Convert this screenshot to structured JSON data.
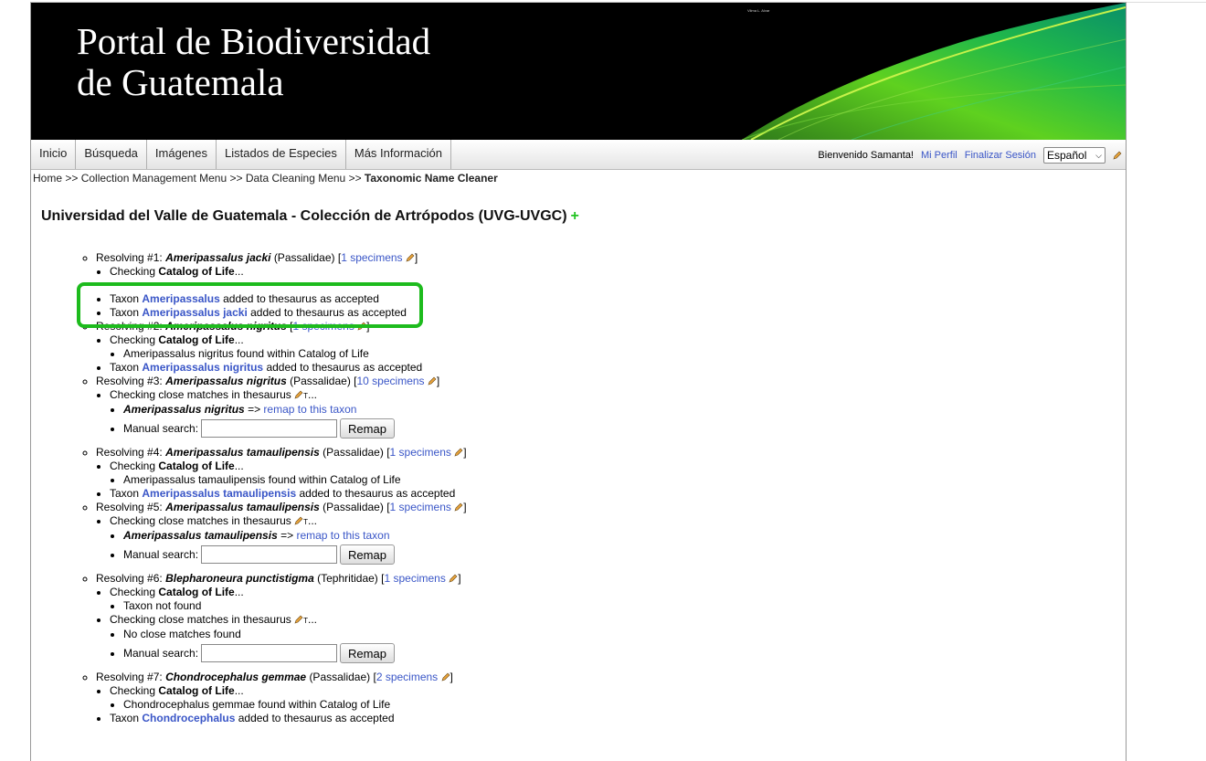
{
  "banner": {
    "title_line1": "Portal de Biodiversidad",
    "title_line2": "de Guatemala",
    "tiny_text": "Vilma L. Alvar"
  },
  "nav": {
    "items": [
      "Inicio",
      "Búsqueda",
      "Imágenes",
      "Listados de Especies",
      "Más Información"
    ]
  },
  "user": {
    "welcome": "Bienvenido Samanta!",
    "profile": "Mi Perfil",
    "logout": "Finalizar Sesión",
    "language": "Español"
  },
  "breadcrumb": {
    "home": "Home >>",
    "cm": "Collection Management Menu >>",
    "dc": "Data Cleaning Menu >>",
    "current": "Taxonomic Name Cleaner"
  },
  "collection_title": "Universidad del Valle de Guatemala - Colección de Artrópodos (UVG-UVGC)",
  "remap_label": "Remap",
  "manual_label": "Manual search:",
  "results": {
    "r1": {
      "head": "Resolving #1:",
      "taxon": "Ameripassalus jacki",
      "family": "(Passalidae)",
      "spec": "1 specimens",
      "check": "Checking",
      "source": "Catalog of Life",
      "t1name": "Ameripassalus",
      "t2name": "Ameripassalus jacki",
      "accepted": "added to thesaurus as accepted"
    },
    "r2": {
      "head": "Resolving #2:",
      "taxon": "Ameripassalus nigritus",
      "spec": "1 specimens",
      "found": "Ameripassalus nigritus found within Catalog of Life",
      "tname": "Ameripassalus nigritus"
    },
    "r3": {
      "head": "Resolving #3:",
      "taxon": "Ameripassalus nigritus",
      "family": "(Passalidae)",
      "spec": "10 specimens",
      "close": "Checking close matches in thesaurus",
      "match": "Ameripassalus nigritus",
      "remap": "remap to this taxon"
    },
    "r4": {
      "head": "Resolving #4:",
      "taxon": "Ameripassalus tamaulipensis",
      "family": "(Passalidae)",
      "spec": "1 specimens",
      "found": "Ameripassalus tamaulipensis found within Catalog of Life",
      "tname": "Ameripassalus tamaulipensis"
    },
    "r5": {
      "head": "Resolving #5:",
      "taxon": "Ameripassalus tamaulipensis",
      "family": "(Passalidae)",
      "spec": "1 specimens",
      "match": "Ameripassalus tamaulipensis"
    },
    "r6": {
      "head": "Resolving #6:",
      "taxon": "Blepharoneura punctistigma",
      "family": "(Tephritidae)",
      "spec": "1 specimens",
      "notfound": "Taxon not found",
      "noclose": "No close matches found"
    },
    "r7": {
      "head": "Resolving #7:",
      "taxon": "Chondrocephalus gemmae",
      "family": "(Passalidae)",
      "spec": "2 specimens",
      "found": "Chondrocephalus gemmae found within Catalog of Life",
      "tname": "Chondrocephalus"
    }
  },
  "common": {
    "taxon_word": "Taxon",
    "arrow": "=>",
    "ellipsis": "...",
    "t_mark": "T"
  },
  "colors": {
    "highlight": "#1dbb1d",
    "link": "#3a56c7"
  }
}
